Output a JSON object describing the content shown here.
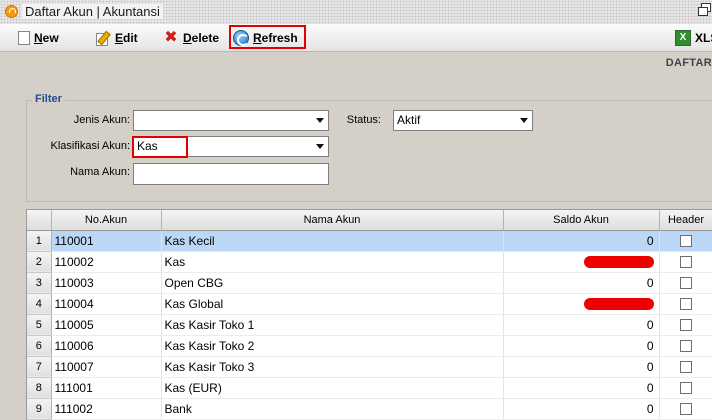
{
  "window": {
    "title": "Daftar Akun | Akuntansi"
  },
  "toolbar": {
    "new_label": "New",
    "edit_label": "Edit",
    "delete_label": "Delete",
    "refresh_label": "Refresh",
    "export_label": "XLS"
  },
  "header": {
    "label": "DAFTAR"
  },
  "filter": {
    "legend": "Filter",
    "jenis_akun": {
      "label": "Jenis Akun:",
      "value": ""
    },
    "status": {
      "label": "Status:",
      "value": "Aktif"
    },
    "klasifikasi_akun": {
      "label": "Klasifikasi Akun:",
      "value": "Kas"
    },
    "nama_akun": {
      "label": "Nama Akun:",
      "value": ""
    }
  },
  "table": {
    "columns": [
      "",
      "No.Akun",
      "Nama Akun",
      "Saldo Akun",
      "Header"
    ],
    "rows": [
      {
        "num": "1",
        "no_akun": "110001",
        "nama": "Kas Kecil",
        "saldo": "0",
        "redacted": false,
        "header": false,
        "selected": true
      },
      {
        "num": "2",
        "no_akun": "110002",
        "nama": "Kas",
        "saldo": "",
        "redacted": true,
        "header": false,
        "selected": false
      },
      {
        "num": "3",
        "no_akun": "110003",
        "nama": "Open CBG",
        "saldo": "0",
        "redacted": false,
        "header": false,
        "selected": false
      },
      {
        "num": "4",
        "no_akun": "110004",
        "nama": "Kas Global",
        "saldo": "",
        "redacted": true,
        "header": false,
        "selected": false
      },
      {
        "num": "5",
        "no_akun": "110005",
        "nama": "Kas Kasir Toko 1",
        "saldo": "0",
        "redacted": false,
        "header": false,
        "selected": false
      },
      {
        "num": "6",
        "no_akun": "110006",
        "nama": "Kas Kasir Toko 2",
        "saldo": "0",
        "redacted": false,
        "header": false,
        "selected": false
      },
      {
        "num": "7",
        "no_akun": "110007",
        "nama": "Kas Kasir Toko 3",
        "saldo": "0",
        "redacted": false,
        "header": false,
        "selected": false
      },
      {
        "num": "8",
        "no_akun": "111001",
        "nama": "Kas (EUR)",
        "saldo": "0",
        "redacted": false,
        "header": false,
        "selected": false
      },
      {
        "num": "9",
        "no_akun": "111002",
        "nama": "Bank",
        "saldo": "0",
        "redacted": false,
        "header": false,
        "selected": false
      }
    ]
  },
  "colors": {
    "selection": "#bcd7f5",
    "highlight": "#e00000",
    "redaction": "#ee0000",
    "legend": "#2a4a8a"
  }
}
